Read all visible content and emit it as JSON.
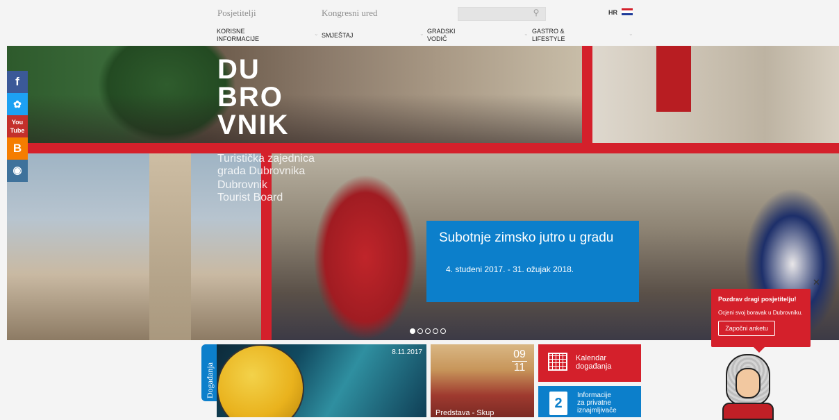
{
  "header": {
    "visitors_link": "Posjetitelji",
    "congress_link": "Kongresni ured",
    "search_placeholder": "",
    "language": "HR"
  },
  "nav": [
    {
      "line1": "KORISNE",
      "line2": "INFORMACIJE"
    },
    {
      "line1": "SMJEŠTAJ",
      "line2": ""
    },
    {
      "line1": "GRADSKI",
      "line2": "VODIČ"
    },
    {
      "line1": "GASTRO &",
      "line2": "LIFESTYLE"
    }
  ],
  "social": [
    {
      "label": "f",
      "color": "#3b5998",
      "icon": "facebook-icon"
    },
    {
      "label": "t",
      "color": "#1da1f2",
      "icon": "twitter-icon"
    },
    {
      "label": "You Tube",
      "color": "#c4302b",
      "icon": "youtube-icon"
    },
    {
      "label": "B",
      "color": "#f57d00",
      "icon": "blogger-icon"
    },
    {
      "label": "◎",
      "color": "#3f729b",
      "icon": "instagram-icon"
    }
  ],
  "logo": {
    "l1": "DU",
    "l2": "BRO",
    "l3": "VNIK"
  },
  "tourist_board": {
    "line1": "Turistička zajednica",
    "line2": "grada Dubrovnika",
    "line3": "Dubrovnik",
    "line4": "Tourist Board"
  },
  "slide": {
    "title": "Subotnje zimsko jutro u gradu",
    "dates": "4. studeni 2017. - 31. ožujak 2018."
  },
  "popup": {
    "title": "Pozdrav dragi posjetitelju!",
    "text": "Ocjeni svoj boravak u Dubrovniku.",
    "button": "Započni anketu",
    "close": "✕"
  },
  "events": {
    "tag": "Događanja",
    "event1_date": "8.11.2017",
    "event2_day": "09",
    "event2_month": "11",
    "event2_caption": "Predstava - Skup"
  },
  "calendar": {
    "line1": "Kalendar",
    "line2": "događanja"
  },
  "private": {
    "line1": "Informacije",
    "line2": "za privatne",
    "line3": "iznajmljivače"
  },
  "colors": {
    "brand_red": "#d4202b",
    "brand_blue": "#0c7fcb"
  }
}
